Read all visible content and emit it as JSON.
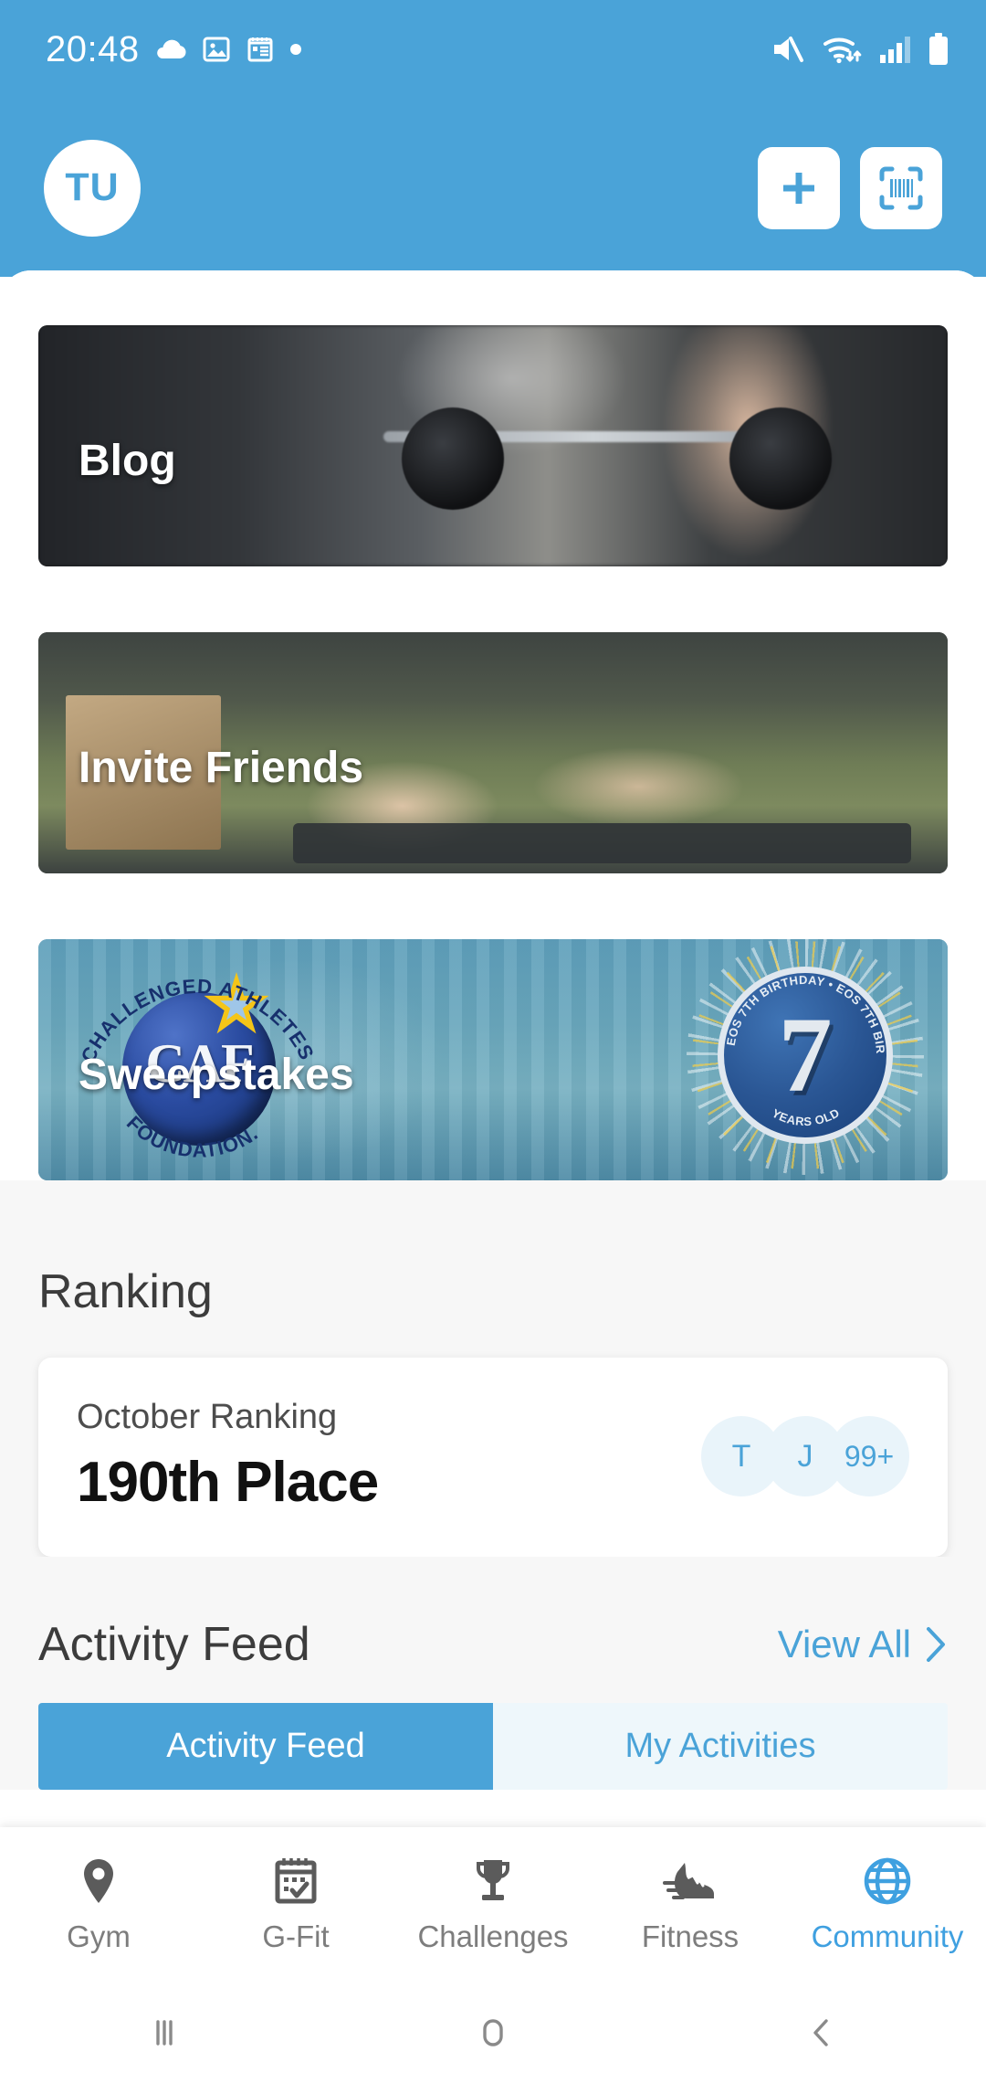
{
  "status_bar": {
    "time": "20:48",
    "left_icons": [
      "cloud-icon",
      "image-icon",
      "notepad-icon",
      "dot-icon"
    ],
    "right_icons": [
      "mute-icon",
      "wifi-icon",
      "signal-icon",
      "battery-icon"
    ]
  },
  "header": {
    "avatar_initials": "TU",
    "add_button": "add-button",
    "scan_button": "scan-barcode-button",
    "background_color": "#4aa3d8"
  },
  "promos": [
    {
      "label": "Blog",
      "name": "blog-card"
    },
    {
      "label": "Invite Friends",
      "name": "invite-friends-card"
    },
    {
      "label": "Sweepstakes",
      "name": "sweepstakes-card"
    }
  ],
  "sweepstakes_art": {
    "logo_top_text": "CHALLENGED ATHLETES",
    "logo_letters": "CAF",
    "logo_bottom_text": "FOUNDATION.",
    "badge_number": "7",
    "badge_label": "YEARS OLD",
    "badge_ring_text": "EOS 7TH BIRTHDAY • EOS 7TH BIRTHDAY •"
  },
  "ranking": {
    "heading": "Ranking",
    "period_label": "October Ranking",
    "place": "190th Place",
    "avatars": [
      "T",
      "J",
      "99+"
    ]
  },
  "activity_feed": {
    "heading": "Activity Feed",
    "view_all": "View All",
    "view_all_chevron": "chevron-right-icon",
    "tabs": [
      {
        "label": "Activity Feed",
        "active": true
      },
      {
        "label": "My Activities",
        "active": false
      }
    ]
  },
  "bottom_nav": [
    {
      "label": "Gym",
      "icon": "location-pin-icon",
      "active": false
    },
    {
      "label": "G-Fit",
      "icon": "calendar-check-icon",
      "active": false
    },
    {
      "label": "Challenges",
      "icon": "trophy-icon",
      "active": false
    },
    {
      "label": "Fitness",
      "icon": "running-shoe-icon",
      "active": false
    },
    {
      "label": "Community",
      "icon": "globe-icon",
      "active": true
    }
  ],
  "system_nav": {
    "recents": "recents-icon",
    "home": "home-icon",
    "back": "back-icon"
  },
  "colors": {
    "brand_blue": "#4aa3d8",
    "accent_blue": "#3fa0e0",
    "avatar_bg": "#e9f4fa",
    "page_gray": "#f7f7f7"
  }
}
